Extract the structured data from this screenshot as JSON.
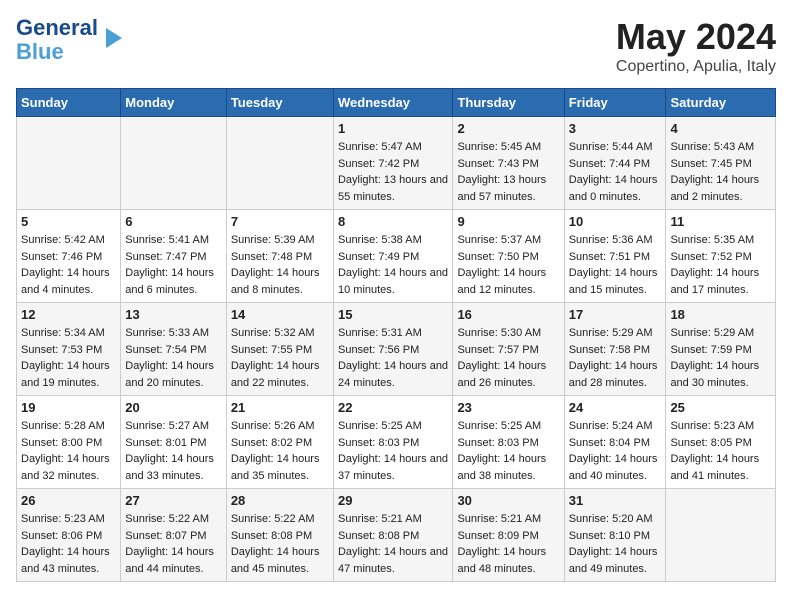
{
  "header": {
    "logo_line1": "General",
    "logo_line2": "Blue",
    "title": "May 2024",
    "subtitle": "Copertino, Apulia, Italy"
  },
  "columns": [
    "Sunday",
    "Monday",
    "Tuesday",
    "Wednesday",
    "Thursday",
    "Friday",
    "Saturday"
  ],
  "weeks": [
    {
      "days": [
        {
          "num": "",
          "info": ""
        },
        {
          "num": "",
          "info": ""
        },
        {
          "num": "",
          "info": ""
        },
        {
          "num": "1",
          "info": "Sunrise: 5:47 AM\nSunset: 7:42 PM\nDaylight: 13 hours and 55 minutes."
        },
        {
          "num": "2",
          "info": "Sunrise: 5:45 AM\nSunset: 7:43 PM\nDaylight: 13 hours and 57 minutes."
        },
        {
          "num": "3",
          "info": "Sunrise: 5:44 AM\nSunset: 7:44 PM\nDaylight: 14 hours and 0 minutes."
        },
        {
          "num": "4",
          "info": "Sunrise: 5:43 AM\nSunset: 7:45 PM\nDaylight: 14 hours and 2 minutes."
        }
      ]
    },
    {
      "days": [
        {
          "num": "5",
          "info": "Sunrise: 5:42 AM\nSunset: 7:46 PM\nDaylight: 14 hours and 4 minutes."
        },
        {
          "num": "6",
          "info": "Sunrise: 5:41 AM\nSunset: 7:47 PM\nDaylight: 14 hours and 6 minutes."
        },
        {
          "num": "7",
          "info": "Sunrise: 5:39 AM\nSunset: 7:48 PM\nDaylight: 14 hours and 8 minutes."
        },
        {
          "num": "8",
          "info": "Sunrise: 5:38 AM\nSunset: 7:49 PM\nDaylight: 14 hours and 10 minutes."
        },
        {
          "num": "9",
          "info": "Sunrise: 5:37 AM\nSunset: 7:50 PM\nDaylight: 14 hours and 12 minutes."
        },
        {
          "num": "10",
          "info": "Sunrise: 5:36 AM\nSunset: 7:51 PM\nDaylight: 14 hours and 15 minutes."
        },
        {
          "num": "11",
          "info": "Sunrise: 5:35 AM\nSunset: 7:52 PM\nDaylight: 14 hours and 17 minutes."
        }
      ]
    },
    {
      "days": [
        {
          "num": "12",
          "info": "Sunrise: 5:34 AM\nSunset: 7:53 PM\nDaylight: 14 hours and 19 minutes."
        },
        {
          "num": "13",
          "info": "Sunrise: 5:33 AM\nSunset: 7:54 PM\nDaylight: 14 hours and 20 minutes."
        },
        {
          "num": "14",
          "info": "Sunrise: 5:32 AM\nSunset: 7:55 PM\nDaylight: 14 hours and 22 minutes."
        },
        {
          "num": "15",
          "info": "Sunrise: 5:31 AM\nSunset: 7:56 PM\nDaylight: 14 hours and 24 minutes."
        },
        {
          "num": "16",
          "info": "Sunrise: 5:30 AM\nSunset: 7:57 PM\nDaylight: 14 hours and 26 minutes."
        },
        {
          "num": "17",
          "info": "Sunrise: 5:29 AM\nSunset: 7:58 PM\nDaylight: 14 hours and 28 minutes."
        },
        {
          "num": "18",
          "info": "Sunrise: 5:29 AM\nSunset: 7:59 PM\nDaylight: 14 hours and 30 minutes."
        }
      ]
    },
    {
      "days": [
        {
          "num": "19",
          "info": "Sunrise: 5:28 AM\nSunset: 8:00 PM\nDaylight: 14 hours and 32 minutes."
        },
        {
          "num": "20",
          "info": "Sunrise: 5:27 AM\nSunset: 8:01 PM\nDaylight: 14 hours and 33 minutes."
        },
        {
          "num": "21",
          "info": "Sunrise: 5:26 AM\nSunset: 8:02 PM\nDaylight: 14 hours and 35 minutes."
        },
        {
          "num": "22",
          "info": "Sunrise: 5:25 AM\nSunset: 8:03 PM\nDaylight: 14 hours and 37 minutes."
        },
        {
          "num": "23",
          "info": "Sunrise: 5:25 AM\nSunset: 8:03 PM\nDaylight: 14 hours and 38 minutes."
        },
        {
          "num": "24",
          "info": "Sunrise: 5:24 AM\nSunset: 8:04 PM\nDaylight: 14 hours and 40 minutes."
        },
        {
          "num": "25",
          "info": "Sunrise: 5:23 AM\nSunset: 8:05 PM\nDaylight: 14 hours and 41 minutes."
        }
      ]
    },
    {
      "days": [
        {
          "num": "26",
          "info": "Sunrise: 5:23 AM\nSunset: 8:06 PM\nDaylight: 14 hours and 43 minutes."
        },
        {
          "num": "27",
          "info": "Sunrise: 5:22 AM\nSunset: 8:07 PM\nDaylight: 14 hours and 44 minutes."
        },
        {
          "num": "28",
          "info": "Sunrise: 5:22 AM\nSunset: 8:08 PM\nDaylight: 14 hours and 45 minutes."
        },
        {
          "num": "29",
          "info": "Sunrise: 5:21 AM\nSunset: 8:08 PM\nDaylight: 14 hours and 47 minutes."
        },
        {
          "num": "30",
          "info": "Sunrise: 5:21 AM\nSunset: 8:09 PM\nDaylight: 14 hours and 48 minutes."
        },
        {
          "num": "31",
          "info": "Sunrise: 5:20 AM\nSunset: 8:10 PM\nDaylight: 14 hours and 49 minutes."
        },
        {
          "num": "",
          "info": ""
        }
      ]
    }
  ]
}
